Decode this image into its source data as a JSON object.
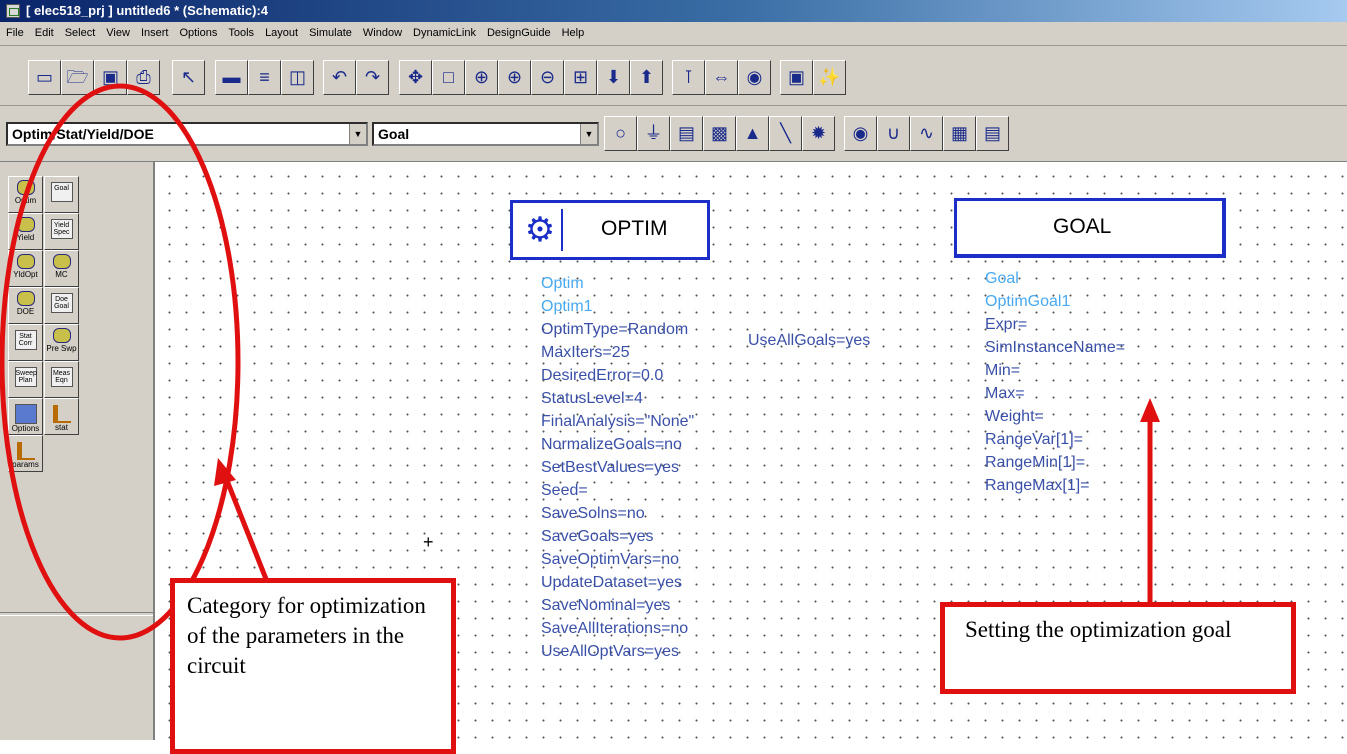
{
  "window": {
    "title": "[ elec518_prj ] untitled6 * (Schematic):4"
  },
  "menu": [
    "File",
    "Edit",
    "Select",
    "View",
    "Insert",
    "Options",
    "Tools",
    "Layout",
    "Simulate",
    "Window",
    "DynamicLink",
    "DesignGuide",
    "Help"
  ],
  "toolbar": {
    "palette_select_value": "Optim/Stat/Yield/DOE",
    "component_select_value": "Goal"
  },
  "palette": {
    "items": [
      {
        "label": "Optim"
      },
      {
        "label": "Goal"
      },
      {
        "label": "Yield"
      },
      {
        "label": "Yield Spec"
      },
      {
        "label": "YldOpt"
      },
      {
        "label": "MC"
      },
      {
        "label": "DOE"
      },
      {
        "label": "Doe Goal"
      },
      {
        "label": "Stat Corr"
      },
      {
        "label": "Pre Swp"
      },
      {
        "label": "Sweep Plan"
      },
      {
        "label": "Meas Eqn"
      },
      {
        "label": "Options"
      },
      {
        "label": "stat"
      },
      {
        "label": "params"
      }
    ]
  },
  "optim_component": {
    "title": "OPTIM",
    "type": "Optim",
    "name": "Optim1",
    "params": [
      "OptimType=Random",
      "MaxIters=25",
      "DesiredError=0.0",
      "StatusLevel=4",
      "FinalAnalysis=\"None\"",
      "NormalizeGoals=no",
      "SetBestValues=yes",
      "Seed=",
      "SaveSolns=no",
      "SaveGoals=yes",
      "SaveOptimVars=no",
      "UpdateDataset=yes",
      "SaveNominal=yes",
      "SaveAllIterations=no",
      "UseAllOptVars=yes"
    ],
    "extra_param": "UseAllGoals=yes"
  },
  "goal_component": {
    "title": "GOAL",
    "type": "Goal",
    "name": "OptimGoal1",
    "params": [
      "Expr=",
      "SimInstanceName=",
      "Min=",
      "Max=",
      "Weight=",
      "RangeVar[1]=",
      "RangeMin[1]=",
      "RangeMax[1]="
    ]
  },
  "annotations": {
    "category_text": "Category for optimization of the parameters in the circuit",
    "goal_text": "Setting the optimization goal",
    "accent_color": "#e01010"
  }
}
